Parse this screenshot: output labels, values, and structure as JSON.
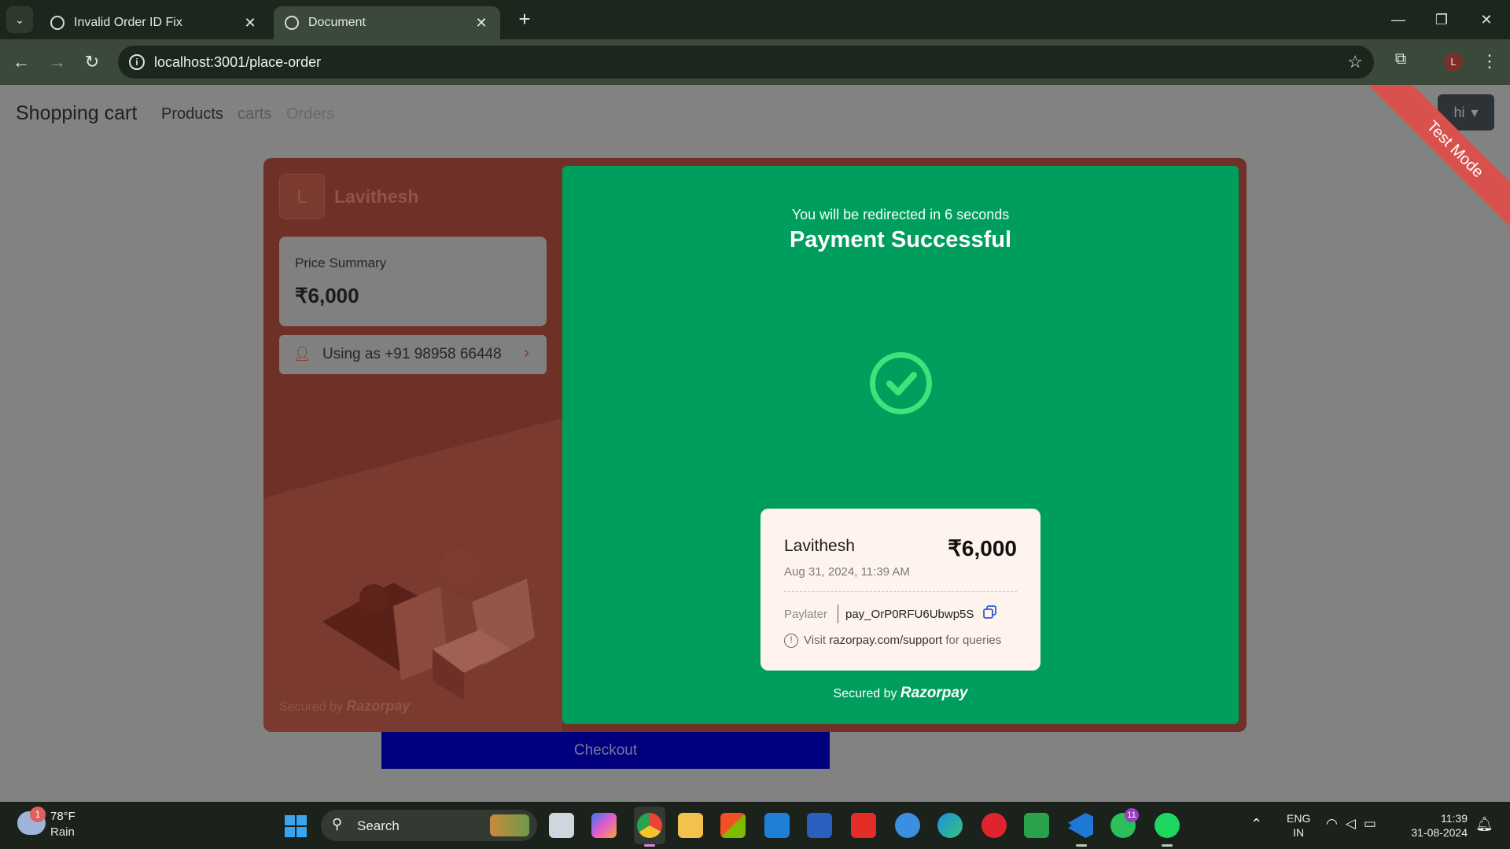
{
  "browser": {
    "tabs": [
      {
        "title": "Invalid Order ID Fix",
        "active": false
      },
      {
        "title": "Document",
        "active": true
      }
    ],
    "url": "localhost:3001/place-order"
  },
  "page": {
    "brand": "Shopping cart",
    "nav": [
      "Products",
      "carts",
      "Orders"
    ],
    "user_menu": "hi",
    "checkout_label": "Checkout",
    "ribbon": "Test Mode"
  },
  "razorpay": {
    "merchant_initial": "L",
    "merchant_name": "Lavithesh",
    "price_summary_label": "Price Summary",
    "price": "₹6,000",
    "using_as": "Using as +91 98958 66448",
    "secured_by": "Secured by",
    "brand": "Razorpay",
    "success": {
      "redirect_text": "You will be redirected in 6 seconds",
      "title": "Payment Successful",
      "receipt": {
        "name": "Lavithesh",
        "amount": "₹6,000",
        "date": "Aug 31, 2024, 11:39 AM",
        "method": "Paylater",
        "payment_id": "pay_OrP0RFU6Ubwp5S",
        "support_prefix": "Visit",
        "support_link": "razorpay.com/support",
        "support_suffix": "for queries"
      }
    }
  },
  "taskbar": {
    "weather_badge": "1",
    "temperature": "78°F",
    "condition": "Rain",
    "search_label": "Search",
    "whatsapp_badge": "11",
    "chrome_profile_badge": "L",
    "lang_line1": "ENG",
    "lang_line2": "IN",
    "time": "11:39",
    "date": "31-08-2024"
  },
  "colors": {
    "success_green": "#009e5c",
    "modal_brown": "#6f3127",
    "checkout_blue": "#00007f",
    "ribbon_red": "#d9514d"
  }
}
